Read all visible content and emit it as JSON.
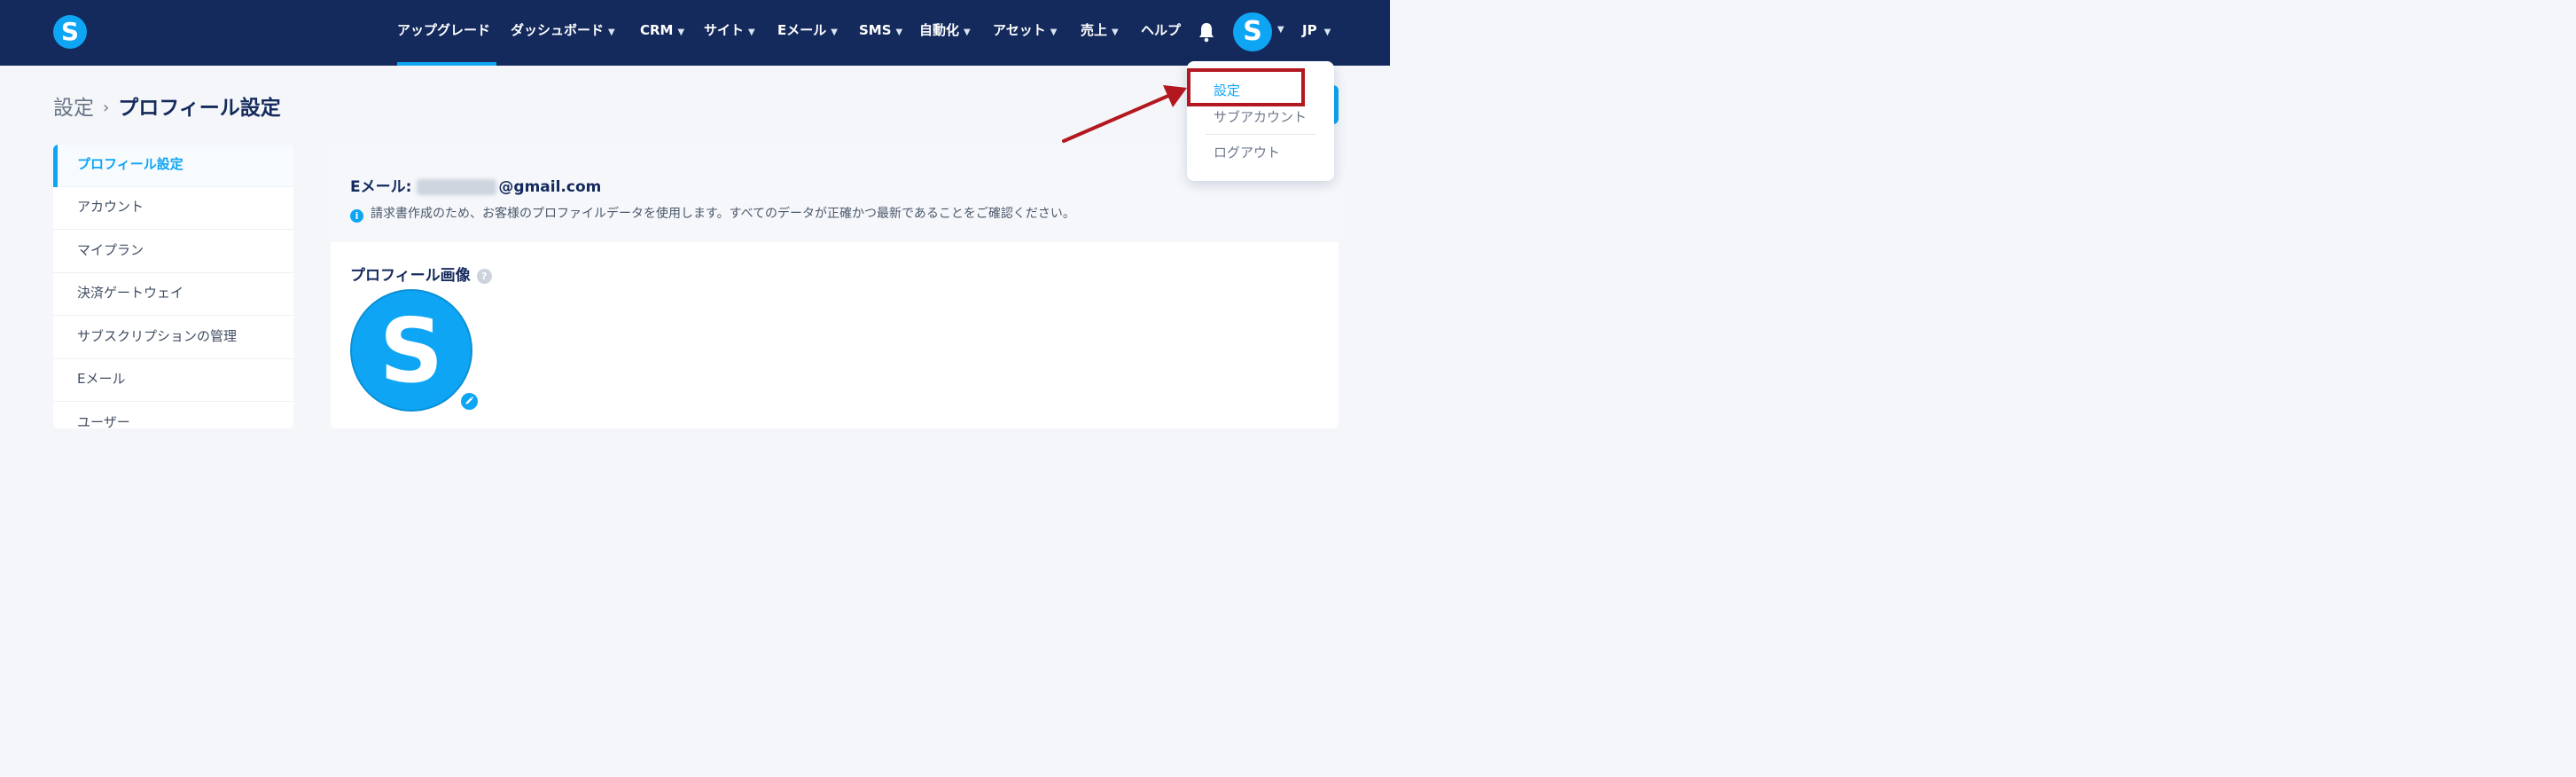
{
  "nav": {
    "items": [
      {
        "label": "アップグレード",
        "chevron": false
      },
      {
        "label": "ダッシュボード",
        "chevron": true
      },
      {
        "label": "CRM",
        "chevron": true
      },
      {
        "label": "サイト",
        "chevron": true
      },
      {
        "label": "Eメール",
        "chevron": true
      },
      {
        "label": "SMS",
        "chevron": true
      },
      {
        "label": "自動化",
        "chevron": true
      },
      {
        "label": "アセット",
        "chevron": true
      },
      {
        "label": "売上",
        "chevron": true
      },
      {
        "label": "ヘルプ",
        "chevron": false
      }
    ],
    "active_item": "アップグレード",
    "logo_letter": "S",
    "avatar_letter": "S",
    "language": "JP"
  },
  "breadcrumb": {
    "parent": "設定",
    "separator": "›",
    "current": "プロフィール設定"
  },
  "sidebar": {
    "items": [
      {
        "label": "プロフィール設定",
        "active": true
      },
      {
        "label": "アカウント",
        "active": false
      },
      {
        "label": "マイプラン",
        "active": false
      },
      {
        "label": "決済ゲートウェイ",
        "active": false
      },
      {
        "label": "サブスクリプションの管理",
        "active": false
      },
      {
        "label": "Eメール",
        "active": false
      },
      {
        "label": "ユーザー",
        "active": false
      }
    ]
  },
  "profile": {
    "email_label": "Eメール:",
    "email_domain": "@gmail.com",
    "info_text": "請求書作成のため、お客様のプロファイルデータを使用します。すべてのデータが正確かつ最新であることをご確認ください。",
    "picture_label": "プロフィール画像",
    "avatar_letter": "S"
  },
  "dropdown": {
    "items": [
      {
        "label": "設定",
        "active": true
      },
      {
        "label": "サブアカウント",
        "active": false
      },
      {
        "label": "ログアウト",
        "active": false
      }
    ]
  },
  "colors": {
    "navbar": "#142a5c",
    "accent": "#0ea5f5",
    "highlight": "#b3171f",
    "background": "#f4f6f9"
  }
}
